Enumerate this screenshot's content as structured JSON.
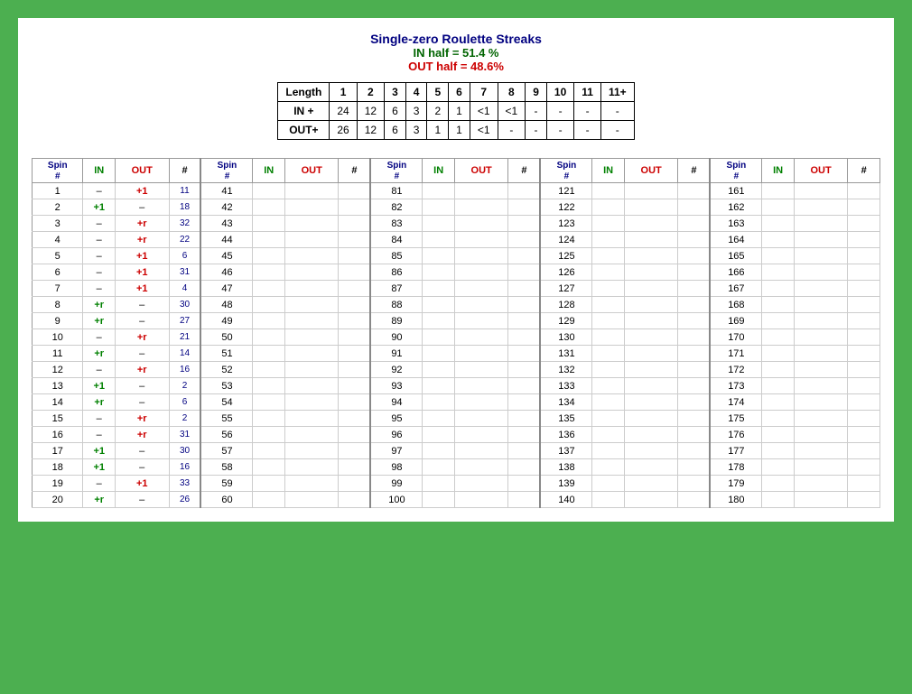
{
  "header": {
    "title": "Single-zero Roulette Streaks",
    "in_half": "IN half = 51.4 %",
    "out_half": "OUT half = 48.6%"
  },
  "summary": {
    "columns": [
      "Length",
      "1",
      "2",
      "3",
      "4",
      "5",
      "6",
      "7",
      "8",
      "9",
      "10",
      "11",
      "11+"
    ],
    "rows": [
      {
        "label": "IN +",
        "values": [
          "24",
          "12",
          "6",
          "3",
          "2",
          "1",
          "<1",
          "<1",
          "-",
          "-",
          "-",
          "-"
        ]
      },
      {
        "label": "OUT+",
        "values": [
          "26",
          "12",
          "6",
          "3",
          "1",
          "1",
          "<1",
          "-",
          "-",
          "-",
          "-",
          "-"
        ]
      }
    ]
  },
  "spin_table": {
    "col_headers": [
      "Spin #",
      "IN",
      "OUT",
      "#"
    ],
    "spins": [
      {
        "spin": 1,
        "in": "-",
        "out": "+1",
        "num": 11
      },
      {
        "spin": 2,
        "in": "+1",
        "out": "-",
        "num": 18
      },
      {
        "spin": 3,
        "in": "-",
        "out": "+r",
        "num": 32
      },
      {
        "spin": 4,
        "in": "-",
        "out": "+r",
        "num": 22
      },
      {
        "spin": 5,
        "in": "-",
        "out": "+1",
        "num": 6
      },
      {
        "spin": 6,
        "in": "-",
        "out": "+1",
        "num": 31
      },
      {
        "spin": 7,
        "in": "-",
        "out": "+1",
        "num": 4
      },
      {
        "spin": 8,
        "in": "+r",
        "out": "-",
        "num": 30
      },
      {
        "spin": 9,
        "in": "+r",
        "out": "-",
        "num": 27
      },
      {
        "spin": 10,
        "in": "-",
        "out": "+r",
        "num": 21
      },
      {
        "spin": 11,
        "in": "+r",
        "out": "-",
        "num": 14
      },
      {
        "spin": 12,
        "in": "-",
        "out": "+r",
        "num": 16
      },
      {
        "spin": 13,
        "in": "+1",
        "out": "-",
        "num": 2
      },
      {
        "spin": 14,
        "in": "+r",
        "out": "-",
        "num": 6
      },
      {
        "spin": 15,
        "in": "-",
        "out": "+r",
        "num": 2
      },
      {
        "spin": 16,
        "in": "-",
        "out": "+r",
        "num": 31
      },
      {
        "spin": 17,
        "in": "+1",
        "out": "-",
        "num": 30
      },
      {
        "spin": 18,
        "in": "+1",
        "out": "-",
        "num": 16
      },
      {
        "spin": 19,
        "in": "-",
        "out": "+1",
        "num": 33
      },
      {
        "spin": 20,
        "in": "+r",
        "out": "-",
        "num": 26
      }
    ],
    "col2_spins": [
      41,
      42,
      43,
      44,
      45,
      46,
      47,
      48,
      49,
      50,
      51,
      52,
      53,
      54,
      55,
      56,
      57,
      58,
      59,
      60
    ],
    "col3_spins": [
      81,
      82,
      83,
      84,
      85,
      86,
      87,
      88,
      89,
      90,
      91,
      92,
      93,
      94,
      95,
      96,
      97,
      98,
      99,
      100
    ],
    "col4_spins": [
      121,
      122,
      123,
      124,
      125,
      126,
      127,
      128,
      129,
      130,
      131,
      132,
      133,
      134,
      135,
      136,
      137,
      138,
      139,
      140
    ],
    "col5_spins": [
      161,
      162,
      163,
      164,
      165,
      166,
      167,
      168,
      169,
      170,
      171,
      172,
      173,
      174,
      175,
      176,
      177,
      178,
      179,
      180
    ]
  }
}
